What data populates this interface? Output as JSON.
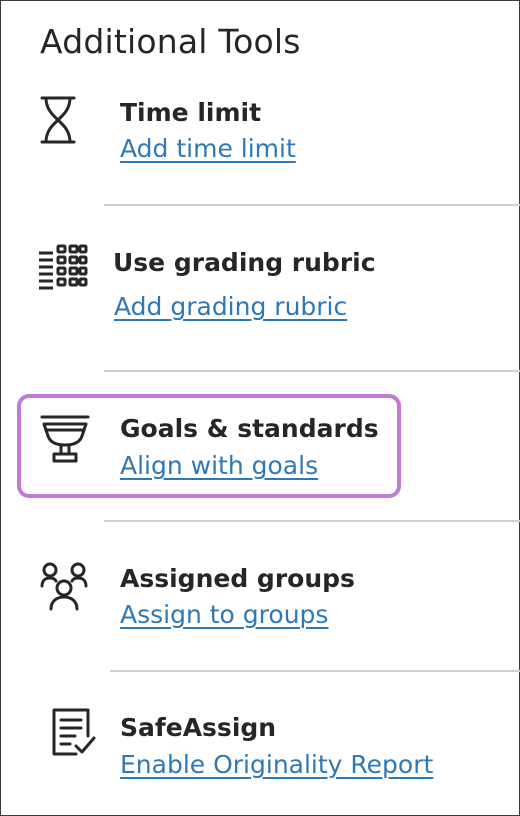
{
  "panel": {
    "title": "Additional Tools"
  },
  "tools": [
    {
      "icon": "hourglass-icon",
      "label": "Time limit",
      "link": "Add time limit"
    },
    {
      "icon": "rubric-icon",
      "label": "Use grading rubric",
      "link": "Add grading rubric"
    },
    {
      "icon": "trophy-icon",
      "label": "Goals & standards",
      "link": "Align with goals"
    },
    {
      "icon": "groups-icon",
      "label": "Assigned groups",
      "link": "Assign to groups"
    },
    {
      "icon": "document-check-icon",
      "label": "SafeAssign",
      "link": "Enable Originality Report"
    }
  ],
  "colors": {
    "link": "#2f79b6",
    "highlight": "#c27bd3",
    "divider": "#cfcfcf",
    "text": "#262626"
  }
}
